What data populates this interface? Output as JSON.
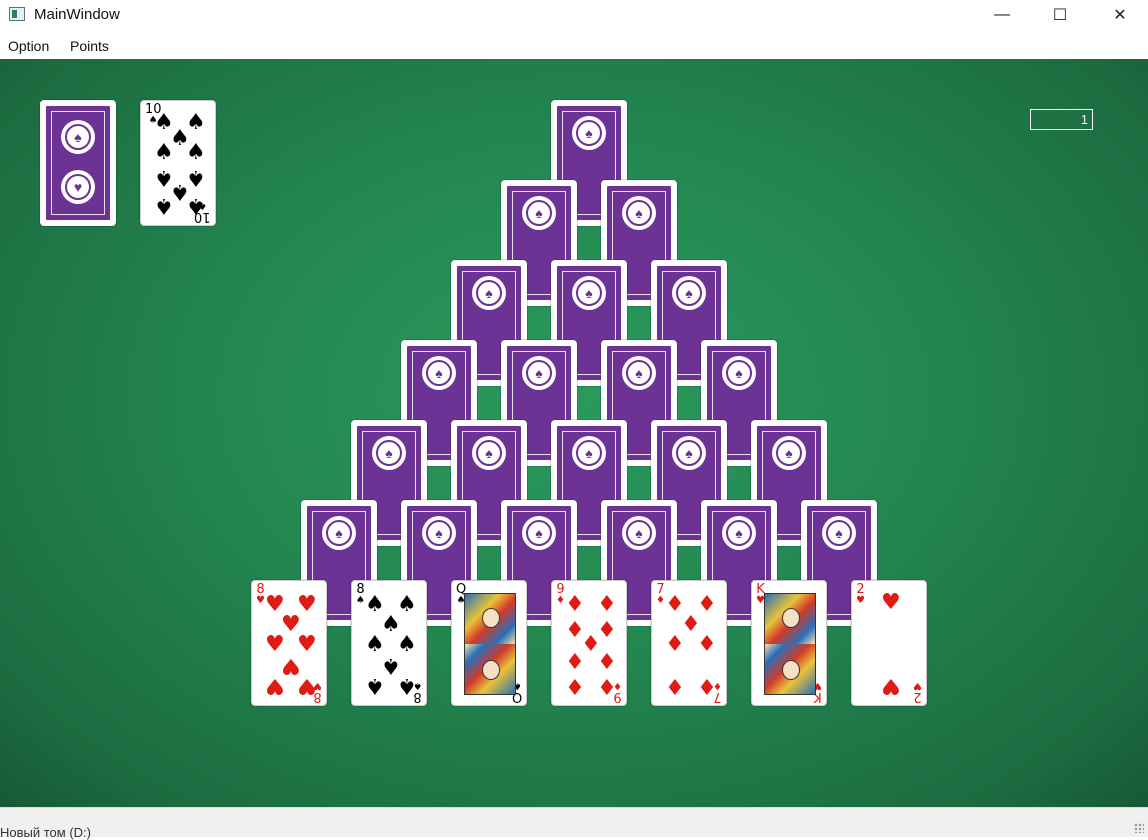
{
  "window": {
    "title": "MainWindow",
    "minimize_glyph": "—",
    "maximize_glyph": "☐",
    "close_glyph": "✕"
  },
  "menu": {
    "items": [
      "Option",
      "Points"
    ]
  },
  "score": {
    "value": "1"
  },
  "status": {
    "text": "Новый том (D:)"
  },
  "colors": {
    "felt": "#238650",
    "card_back": "#6c3294",
    "red_suit": "#e01b14"
  },
  "stock": {
    "face_down": true
  },
  "waste": {
    "rank": "10",
    "suit": "♠",
    "color": "black"
  },
  "pyramid": {
    "rows": [
      1,
      2,
      3,
      4,
      5,
      6
    ],
    "face_down": true
  },
  "bottom_row": [
    {
      "rank": "8",
      "suit": "♥",
      "color": "red",
      "type": "pips",
      "count": 8
    },
    {
      "rank": "8",
      "suit": "♠",
      "color": "black",
      "type": "pips",
      "count": 8
    },
    {
      "rank": "Q",
      "suit": "♠",
      "color": "black",
      "type": "court"
    },
    {
      "rank": "9",
      "suit": "♦",
      "color": "red",
      "type": "pips",
      "count": 9
    },
    {
      "rank": "7",
      "suit": "♦",
      "color": "red",
      "type": "pips",
      "count": 7
    },
    {
      "rank": "K",
      "suit": "♥",
      "color": "red",
      "type": "court"
    },
    {
      "rank": "2",
      "suit": "♥",
      "color": "red",
      "type": "pips",
      "count": 2
    }
  ]
}
